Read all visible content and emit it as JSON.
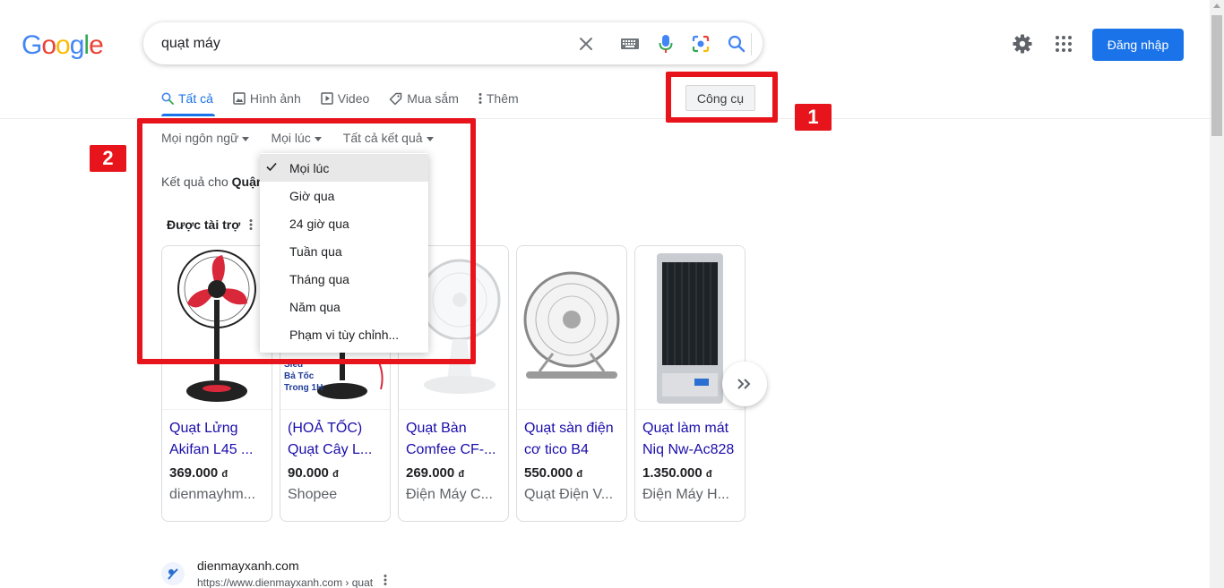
{
  "logo": {
    "letters": [
      "G",
      "o",
      "o",
      "g",
      "l",
      "e"
    ],
    "colors": [
      "#4285f4",
      "#ea4335",
      "#fbbc05",
      "#4285f4",
      "#34a853",
      "#ea4335"
    ]
  },
  "search": {
    "query": "quạt máy"
  },
  "header": {
    "signin_label": "Đăng nhập"
  },
  "tabs": [
    {
      "label": "Tất cả",
      "icon": "search-icon"
    },
    {
      "label": "Hình ảnh",
      "icon": "image-icon"
    },
    {
      "label": "Video",
      "icon": "play-icon"
    },
    {
      "label": "Mua sắm",
      "icon": "tag-icon"
    },
    {
      "label": "Thêm",
      "icon": "more-vert-icon"
    }
  ],
  "tools": {
    "label": "Công cụ"
  },
  "filters": [
    {
      "label": "Mọi ngôn ngữ"
    },
    {
      "label": "Mọi lúc"
    },
    {
      "label": "Tất cả kết quả"
    }
  ],
  "results_for": {
    "prefix": "Kết quả cho",
    "term": "Quận"
  },
  "sponsored": {
    "label": "Được tài trợ"
  },
  "time_menu": {
    "items": [
      "Mọi lúc",
      "Giờ qua",
      "24 giờ qua",
      "Tuần qua",
      "Tháng qua",
      "Năm qua",
      "Phạm vi tùy chỉnh..."
    ],
    "selected": "Mọi lúc"
  },
  "products": [
    {
      "title": "Quạt Lửng Akifan L45 ...",
      "price": "369.000",
      "currency": "đ",
      "seller": "dienmayhm..."
    },
    {
      "title": "(HOẢ TỐC) Quạt Cây L...",
      "price": "90.000",
      "currency": "đ",
      "seller": "Shopee",
      "img_text": [
        "Siêu",
        "Bả Tốc",
        "Trong 1H"
      ]
    },
    {
      "title": "Quạt Bàn Comfee CF-...",
      "price": "269.000",
      "currency": "đ",
      "seller": "Điện Máy C..."
    },
    {
      "title": "Quạt sàn điện cơ tico B4",
      "price": "550.000",
      "currency": "đ",
      "seller": "Quạt Điện V..."
    },
    {
      "title": "Quạt làm mát Niq Nw-Ac828",
      "price": "1.350.000",
      "currency": "đ",
      "seller": "Điện Máy H..."
    }
  ],
  "site_result": {
    "name": "dienmayxanh.com",
    "url": "https://www.dienmayxanh.com › quat"
  },
  "annotations": {
    "badge1": "1",
    "badge2": "2",
    "color": "#e8141c"
  }
}
